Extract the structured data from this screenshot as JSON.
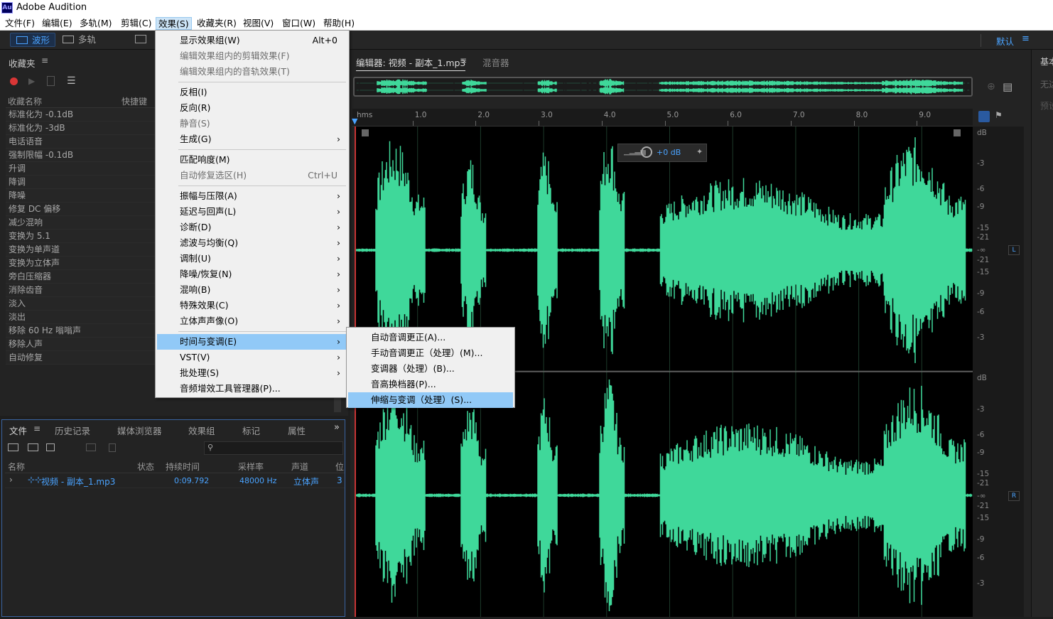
{
  "app": {
    "logo": "Au",
    "title": "Adobe Audition"
  },
  "menubar": [
    "文件(F)",
    "编辑(E)",
    "多轨(M)",
    "剪辑(C)",
    "效果(S)",
    "收藏夹(R)",
    "视图(V)",
    "窗口(W)",
    "帮助(H)"
  ],
  "toolbar": {
    "waveform_label": "波形",
    "multitrack_label": "多轨",
    "workspace": "默认"
  },
  "favorites": {
    "title": "收藏夹",
    "col_name": "收藏名称",
    "col_shortcut": "快捷键",
    "items": [
      "标准化为 -0.1dB",
      "标准化为 -3dB",
      "电话语音",
      "强制限幅 -0.1dB",
      "升调",
      "降调",
      "降噪",
      "修复 DC 偏移",
      "减少混响",
      "变换为 5.1",
      "变换为单声道",
      "变换为立体声",
      "旁白压缩器",
      "消除齿音",
      "淡入",
      "淡出",
      "移除 60 Hz 嗡嗡声",
      "移除人声",
      "自动修复"
    ]
  },
  "files_panel": {
    "tabs": [
      "文件",
      "历史记录",
      "媒体浏览器",
      "效果组",
      "标记",
      "属性"
    ],
    "columns": [
      "名称",
      "状态",
      "持续时间",
      "采样率",
      "声道",
      "位"
    ],
    "rows": [
      {
        "name": "视频 - 副本_1.mp3",
        "duration": "0:09.792",
        "rate": "48000 Hz",
        "channels": "立体声",
        "bits": "3"
      }
    ]
  },
  "editor": {
    "tab_label": "编辑器: 视频 - 副本_1.mp3",
    "mixer_label": "混音器",
    "ruler_unit": "hms",
    "ruler_labels": [
      "1.0",
      "2.0",
      "3.0",
      "4.0",
      "5.0",
      "6.0",
      "7.0",
      "8.0",
      "9.0"
    ],
    "hud_gain": "+0 dB",
    "db_unit": "dB",
    "db_labels_top": [
      "-3",
      "-6",
      "-9",
      "-15",
      "-21",
      "-∞",
      "-21",
      "-15",
      "-9",
      "-6",
      "-3"
    ],
    "channel_left": "L",
    "channel_right": "R",
    "wave_color": "#3fd89a"
  },
  "right_panel": {
    "label1": "基本",
    "label2": "无达",
    "label3": "预设"
  },
  "effects_menu": {
    "items": [
      {
        "label": "显示效果组(W)",
        "shortcut": "Alt+0"
      },
      {
        "label": "编辑效果组内的剪辑效果(F)",
        "disabled": true
      },
      {
        "label": "编辑效果组内的音轨效果(T)",
        "disabled": true
      },
      {
        "label": "反相(I)"
      },
      {
        "label": "反向(R)"
      },
      {
        "label": "静音(S)",
        "disabled": true
      },
      {
        "label": "生成(G)",
        "submenu": true
      },
      {
        "label": "匹配响度(M)"
      },
      {
        "label": "自动修复选区(H)",
        "shortcut": "Ctrl+U",
        "disabled": true
      },
      {
        "label": "振幅与压限(A)",
        "submenu": true
      },
      {
        "label": "延迟与回声(L)",
        "submenu": true
      },
      {
        "label": "诊断(D)",
        "submenu": true
      },
      {
        "label": "滤波与均衡(Q)",
        "submenu": true
      },
      {
        "label": "调制(U)",
        "submenu": true
      },
      {
        "label": "降噪/恢复(N)",
        "submenu": true
      },
      {
        "label": "混响(B)",
        "submenu": true
      },
      {
        "label": "特殊效果(C)",
        "submenu": true
      },
      {
        "label": "立体声声像(O)",
        "submenu": true
      },
      {
        "label": "时间与变调(E)",
        "submenu": true,
        "highlighted": true
      },
      {
        "label": "VST(V)",
        "submenu": true
      },
      {
        "label": "批处理(S)",
        "submenu": true
      },
      {
        "label": "音频增效工具管理器(P)..."
      }
    ]
  },
  "submenu": {
    "items": [
      {
        "label": "自动音调更正(A)..."
      },
      {
        "label": "手动音调更正（处理）(M)..."
      },
      {
        "label": "变调器（处理）(B)..."
      },
      {
        "label": "音高换档器(P)..."
      },
      {
        "label": "伸缩与变调（处理）(S)...",
        "highlighted": true
      }
    ]
  }
}
